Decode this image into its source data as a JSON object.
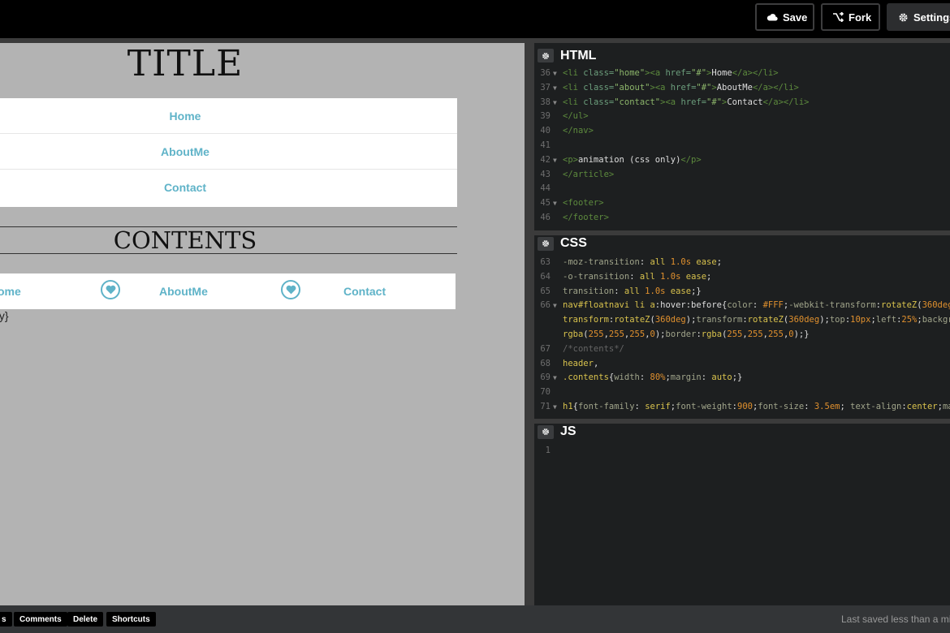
{
  "topbar": {
    "save_label": "Save",
    "fork_label": "Fork",
    "settings_label": "Settings"
  },
  "preview": {
    "title": "TITLE",
    "menu": [
      "Home",
      "AboutMe",
      "Contact"
    ],
    "contents_heading": "CONTENTS",
    "nav": [
      "ome",
      "AboutMe",
      "Contact"
    ],
    "paragraph_tail": "nly}"
  },
  "html_panel": {
    "title": "HTML",
    "lines": [
      {
        "n": "36",
        "fold": true,
        "segs": [
          {
            "c": "tg",
            "t": "<li "
          },
          {
            "c": "at",
            "t": "class="
          },
          {
            "c": "av",
            "t": "\"home\""
          },
          {
            "c": "tg",
            "t": "><a "
          },
          {
            "c": "at",
            "t": "href="
          },
          {
            "c": "av",
            "t": "\"#\""
          },
          {
            "c": "tg",
            "t": ">"
          },
          {
            "c": "tx",
            "t": "Home"
          },
          {
            "c": "tg",
            "t": "</a></li>"
          }
        ]
      },
      {
        "n": "37",
        "fold": true,
        "segs": [
          {
            "c": "tg",
            "t": "<li "
          },
          {
            "c": "at",
            "t": "class="
          },
          {
            "c": "av",
            "t": "\"about\""
          },
          {
            "c": "tg",
            "t": "><a "
          },
          {
            "c": "at",
            "t": "href="
          },
          {
            "c": "av",
            "t": "\"#\""
          },
          {
            "c": "tg",
            "t": ">"
          },
          {
            "c": "tx",
            "t": "AboutMe"
          },
          {
            "c": "tg",
            "t": "</a></li>"
          }
        ]
      },
      {
        "n": "38",
        "fold": true,
        "segs": [
          {
            "c": "tg",
            "t": "<li "
          },
          {
            "c": "at",
            "t": "class="
          },
          {
            "c": "av",
            "t": "\"contact\""
          },
          {
            "c": "tg",
            "t": "><a "
          },
          {
            "c": "at",
            "t": "href="
          },
          {
            "c": "av",
            "t": "\"#\""
          },
          {
            "c": "tg",
            "t": ">"
          },
          {
            "c": "tx",
            "t": "Contact"
          },
          {
            "c": "tg",
            "t": "</a></li>"
          }
        ]
      },
      {
        "n": "39",
        "fold": false,
        "segs": [
          {
            "c": "tg",
            "t": "</ul>"
          }
        ]
      },
      {
        "n": "40",
        "fold": false,
        "segs": [
          {
            "c": "tg",
            "t": "</nav>"
          }
        ]
      },
      {
        "n": "41",
        "fold": false,
        "segs": []
      },
      {
        "n": "42",
        "fold": true,
        "segs": [
          {
            "c": "tg",
            "t": "<p>"
          },
          {
            "c": "tx",
            "t": "animation (css only)"
          },
          {
            "c": "tg",
            "t": "</p>"
          }
        ]
      },
      {
        "n": "43",
        "fold": false,
        "segs": [
          {
            "c": "tg",
            "t": "</article>"
          }
        ]
      },
      {
        "n": "44",
        "fold": false,
        "segs": []
      },
      {
        "n": "45",
        "fold": true,
        "segs": [
          {
            "c": "tg",
            "t": "<footer>"
          }
        ]
      },
      {
        "n": "46",
        "fold": false,
        "segs": [
          {
            "c": "tg",
            "t": "</footer>"
          }
        ]
      }
    ]
  },
  "css_panel": {
    "title": "CSS",
    "lines": [
      {
        "n": "63",
        "fold": false,
        "segs": [
          {
            "c": "pr",
            "t": "-moz-transition"
          },
          {
            "c": "tx",
            "t": ": "
          },
          {
            "c": "kw",
            "t": "all "
          },
          {
            "c": "nm",
            "t": "1.0s "
          },
          {
            "c": "kw",
            "t": "ease"
          },
          {
            "c": "tx",
            "t": ";"
          }
        ]
      },
      {
        "n": "64",
        "fold": false,
        "segs": [
          {
            "c": "pr",
            "t": "-o-transition"
          },
          {
            "c": "tx",
            "t": ": "
          },
          {
            "c": "kw",
            "t": "all "
          },
          {
            "c": "nm",
            "t": "1.0s "
          },
          {
            "c": "kw",
            "t": "ease"
          },
          {
            "c": "tx",
            "t": ";"
          }
        ]
      },
      {
        "n": "65",
        "fold": false,
        "segs": [
          {
            "c": "pr",
            "t": "transition"
          },
          {
            "c": "tx",
            "t": ": "
          },
          {
            "c": "kw",
            "t": "all "
          },
          {
            "c": "nm",
            "t": "1.0s "
          },
          {
            "c": "kw",
            "t": "ease"
          },
          {
            "c": "tx",
            "t": ";}"
          }
        ]
      },
      {
        "n": "66",
        "fold": true,
        "segs": [
          {
            "c": "kw",
            "t": "nav#floatnavi li a"
          },
          {
            "c": "tx",
            "t": ":hover:before{"
          },
          {
            "c": "pr",
            "t": "color"
          },
          {
            "c": "tx",
            "t": ": "
          },
          {
            "c": "nm",
            "t": "#FFF"
          },
          {
            "c": "tx",
            "t": ";"
          },
          {
            "c": "pr",
            "t": "-webkit-transform"
          },
          {
            "c": "tx",
            "t": ":"
          },
          {
            "c": "kw",
            "t": "rotateZ"
          },
          {
            "c": "tx",
            "t": "("
          },
          {
            "c": "nm",
            "t": "360deg"
          },
          {
            "c": "tx",
            "t": ");"
          }
        ]
      },
      {
        "n": "",
        "fold": false,
        "segs": [
          {
            "c": "kw",
            "t": "transform"
          },
          {
            "c": "tx",
            "t": ":"
          },
          {
            "c": "kw",
            "t": "rotateZ"
          },
          {
            "c": "tx",
            "t": "("
          },
          {
            "c": "nm",
            "t": "360deg"
          },
          {
            "c": "tx",
            "t": ");"
          },
          {
            "c": "pr",
            "t": "transform"
          },
          {
            "c": "tx",
            "t": ":"
          },
          {
            "c": "kw",
            "t": "rotateZ"
          },
          {
            "c": "tx",
            "t": "("
          },
          {
            "c": "nm",
            "t": "360deg"
          },
          {
            "c": "tx",
            "t": ");"
          },
          {
            "c": "pr",
            "t": "top"
          },
          {
            "c": "tx",
            "t": ":"
          },
          {
            "c": "nm",
            "t": "10px"
          },
          {
            "c": "tx",
            "t": ";"
          },
          {
            "c": "pr",
            "t": "left"
          },
          {
            "c": "tx",
            "t": ":"
          },
          {
            "c": "nm",
            "t": "25%"
          },
          {
            "c": "tx",
            "t": ";"
          },
          {
            "c": "pr",
            "t": "background"
          }
        ]
      },
      {
        "n": "",
        "fold": false,
        "segs": [
          {
            "c": "kw",
            "t": "rgba"
          },
          {
            "c": "tx",
            "t": "("
          },
          {
            "c": "nm",
            "t": "255"
          },
          {
            "c": "tx",
            "t": ","
          },
          {
            "c": "nm",
            "t": "255"
          },
          {
            "c": "tx",
            "t": ","
          },
          {
            "c": "nm",
            "t": "255"
          },
          {
            "c": "tx",
            "t": ","
          },
          {
            "c": "nm",
            "t": "0"
          },
          {
            "c": "tx",
            "t": ");"
          },
          {
            "c": "pr",
            "t": "border"
          },
          {
            "c": "tx",
            "t": ":"
          },
          {
            "c": "kw",
            "t": "rgba"
          },
          {
            "c": "tx",
            "t": "("
          },
          {
            "c": "nm",
            "t": "255"
          },
          {
            "c": "tx",
            "t": ","
          },
          {
            "c": "nm",
            "t": "255"
          },
          {
            "c": "tx",
            "t": ","
          },
          {
            "c": "nm",
            "t": "255"
          },
          {
            "c": "tx",
            "t": ","
          },
          {
            "c": "nm",
            "t": "0"
          },
          {
            "c": "tx",
            "t": ");}"
          }
        ]
      },
      {
        "n": "67",
        "fold": false,
        "segs": [
          {
            "c": "cm",
            "t": "/*contents*/"
          }
        ]
      },
      {
        "n": "68",
        "fold": false,
        "segs": [
          {
            "c": "kw",
            "t": "header"
          },
          {
            "c": "tx",
            "t": ","
          }
        ]
      },
      {
        "n": "69",
        "fold": true,
        "segs": [
          {
            "c": "kw",
            "t": ".contents"
          },
          {
            "c": "tx",
            "t": "{"
          },
          {
            "c": "pr",
            "t": "width"
          },
          {
            "c": "tx",
            "t": ": "
          },
          {
            "c": "nm",
            "t": "80%"
          },
          {
            "c": "tx",
            "t": ";"
          },
          {
            "c": "pr",
            "t": "margin"
          },
          {
            "c": "tx",
            "t": ": "
          },
          {
            "c": "kw",
            "t": "auto"
          },
          {
            "c": "tx",
            "t": ";}"
          }
        ]
      },
      {
        "n": "70",
        "fold": false,
        "segs": []
      },
      {
        "n": "71",
        "fold": true,
        "segs": [
          {
            "c": "kw",
            "t": "h1"
          },
          {
            "c": "tx",
            "t": "{"
          },
          {
            "c": "pr",
            "t": "font-family"
          },
          {
            "c": "tx",
            "t": ": "
          },
          {
            "c": "kw",
            "t": "serif"
          },
          {
            "c": "tx",
            "t": ";"
          },
          {
            "c": "pr",
            "t": "font-weight"
          },
          {
            "c": "tx",
            "t": ":"
          },
          {
            "c": "nm",
            "t": "900"
          },
          {
            "c": "tx",
            "t": ";"
          },
          {
            "c": "pr",
            "t": "font-size"
          },
          {
            "c": "tx",
            "t": ": "
          },
          {
            "c": "nm",
            "t": "3.5em"
          },
          {
            "c": "tx",
            "t": "; "
          },
          {
            "c": "pr",
            "t": "text-align"
          },
          {
            "c": "tx",
            "t": ":"
          },
          {
            "c": "kw",
            "t": "center"
          },
          {
            "c": "tx",
            "t": ";"
          },
          {
            "c": "pr",
            "t": "margin"
          }
        ]
      }
    ]
  },
  "js_panel": {
    "title": "JS",
    "lines": [
      {
        "n": "1",
        "fold": false,
        "segs": []
      }
    ]
  },
  "bottombar": {
    "buttons": [
      "s",
      "Comments",
      "Delete",
      "Shortcuts"
    ],
    "last_saved": "Last saved less than a min"
  },
  "colors": {
    "accent": "#5fb3c8",
    "topbar_bg": "#000000",
    "editor_bg": "#1d1f20",
    "preview_bg": "#b3b3b3"
  }
}
